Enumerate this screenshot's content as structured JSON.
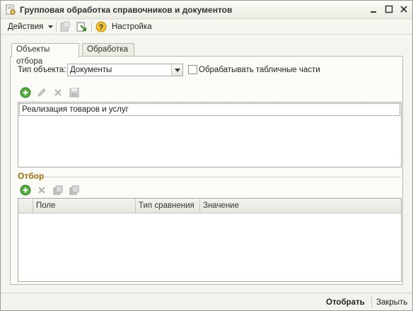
{
  "window": {
    "title": "Групповая обработка справочников и документов",
    "icons": {
      "title": "document-gear-icon",
      "minimize": "minimize-icon",
      "maximize": "maximize-icon",
      "close": "close-icon"
    }
  },
  "toolbar": {
    "actions_label": "Действия",
    "settings_label": "Настройка",
    "icons": [
      "dropdown-arrow-icon",
      "save-disabled-icon",
      "restore-settings-icon",
      "help-icon"
    ]
  },
  "tabs": [
    {
      "label": "Объекты отбора",
      "active": true
    },
    {
      "label": "Обработка",
      "active": false
    }
  ],
  "object_type": {
    "label": "Тип объекта:",
    "value": "Документы",
    "process_tabular_label": "Обрабатывать табличные части",
    "process_tabular_checked": false
  },
  "objects_toolbar": {
    "icons": [
      "add-icon",
      "edit-icon",
      "delete-icon",
      "save-icon"
    ]
  },
  "objects_list": [
    "Реализация товаров и услуг"
  ],
  "filter": {
    "title": "Отбор",
    "toolbar_icons": [
      "add-icon",
      "delete-icon",
      "copy-icon",
      "copy-all-icon"
    ],
    "columns": [
      "Поле",
      "Тип сравнения",
      "Значение"
    ]
  },
  "footer": {
    "select_label": "Отобрать",
    "close_label": "Закрыть"
  },
  "colors": {
    "accent_group_title": "#9a6a0a",
    "add_green": "#3a9a2a",
    "window_bg": "#f5f5f0"
  }
}
